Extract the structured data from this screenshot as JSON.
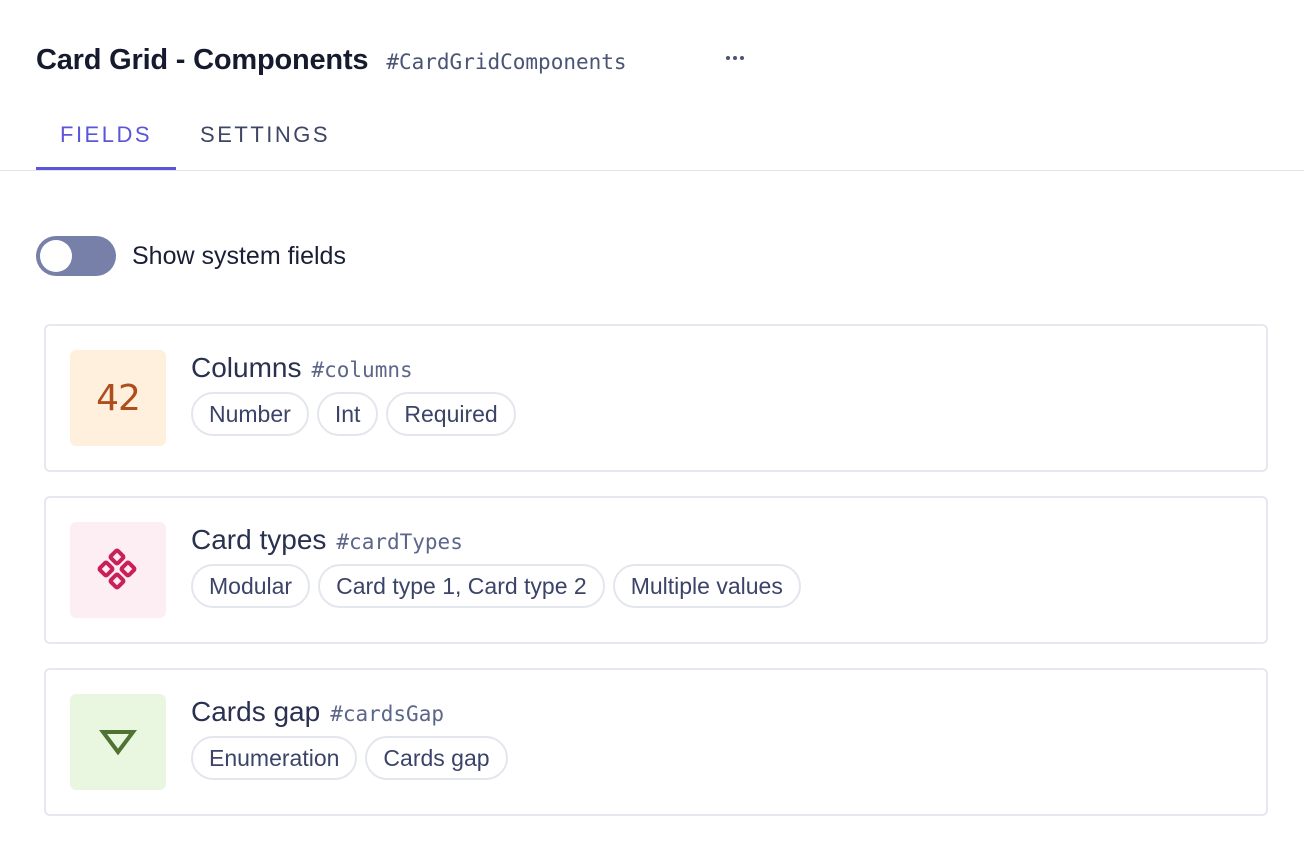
{
  "header": {
    "title": "Card Grid - Components",
    "api_id": "#CardGridComponents",
    "more_icon": "more-horizontal-icon"
  },
  "tabs": [
    {
      "label": "FIELDS",
      "active": true
    },
    {
      "label": "SETTINGS",
      "active": false
    }
  ],
  "system_fields_toggle": {
    "label": "Show system fields",
    "checked": false
  },
  "fields": [
    {
      "name": "Columns",
      "api_id": "#columns",
      "icon": "number-icon",
      "icon_text": "42",
      "icon_bg": "#fef0dc",
      "icon_color": "#ae4e1d",
      "tags": [
        "Number",
        "Int",
        "Required"
      ]
    },
    {
      "name": "Card types",
      "api_id": "#cardTypes",
      "icon": "modular-icon",
      "icon_bg": "#fdeef4",
      "icon_color": "#c9205a",
      "tags": [
        "Modular",
        "Card type 1, Card type 2",
        "Multiple values"
      ]
    },
    {
      "name": "Cards gap",
      "api_id": "#cardsGap",
      "icon": "enumeration-icon",
      "icon_bg": "#e9f7e1",
      "icon_color": "#4f7332",
      "tags": [
        "Enumeration",
        "Cards gap"
      ]
    }
  ]
}
